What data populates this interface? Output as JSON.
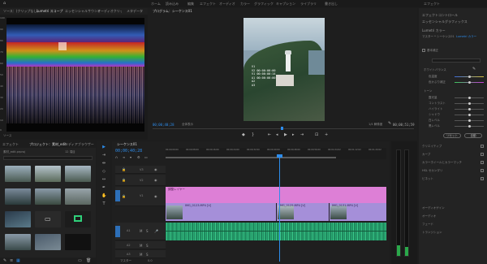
{
  "menu": {
    "items": [
      "ホーム",
      "読み込み",
      "編集",
      "エフェクト",
      "オーディオ",
      "カラー",
      "グラフィック",
      "キャプション",
      "ライブラリ",
      "書き出し"
    ],
    "active_index": 3,
    "right_label": "エフェクト"
  },
  "source_panel": {
    "tabs": [
      "ソース：(クリップなし)",
      "Lumetri スコープ",
      "エッセンシャルサウンド",
      "オーディオクリップミキサー：シーケンス01",
      "メタデータ"
    ],
    "active_tab": 1,
    "bottom_left": "ソース",
    "scale_labels": [
      "100",
      "90",
      "80",
      "70",
      "60",
      "50",
      "40",
      "30",
      "20",
      "10",
      "0"
    ]
  },
  "program": {
    "title": "プログラム：シーケンス01",
    "overlay_lines": [
      "V1",
      "V2 00:00:00:00",
      "V1 00:00:00:14",
      "A1 00:00:00:00",
      "A2",
      "A3"
    ],
    "timecode_left": "00;00;40;28",
    "fit_label": "全体表示",
    "quality_label": "1/4 解像度",
    "timecode_right": "00;00;51;59"
  },
  "effects_panel": {
    "header": "エフェクトコントロール",
    "subheader": "エッセンシャルグラフィックス",
    "sections": [
      "Lumetri カラー",
      "基本補正",
      "クリエイティブ",
      "カーブ",
      "カラーホイールとカラーマッチ",
      "HSL セカンダリ",
      "ビネット"
    ],
    "source_row": "マスター * シーケンス01",
    "clip_row": "Lumetri カラー",
    "sliders": [
      "ホワイトバランス",
      "色温度",
      "色かぶり補正",
      "トーン",
      "露光量",
      "コントラスト",
      "ハイライト",
      "シャドウ",
      "白レベル",
      "黒レベル"
    ],
    "slider_positions": [
      0.5,
      0.5,
      0.5,
      0.5,
      0.5,
      0.5,
      0.5,
      0.5,
      0.5,
      0.5
    ],
    "buttons": [
      "リセット",
      "自動"
    ],
    "lower_items": [
      "オーディオゲイン",
      "オーディオ",
      "フェード",
      "トランジション"
    ]
  },
  "project_panel": {
    "tabs": [
      "エフェクト",
      "プロジェクト：素材_edit",
      "メディアブラウザー"
    ],
    "active_tab": 1,
    "path": "素材_edit.prproj",
    "item_count": "12 項目"
  },
  "timeline": {
    "tab": "シーケンス01",
    "timecode": "00;00;40;28",
    "ruler_labels": [
      "00;00;00;00",
      "00;00;08;00",
      "00;00;16;00",
      "00;00;24;00",
      "00;00;32;00",
      "00;00;40;00",
      "00;00;48;00",
      "00;00;56;00",
      "00;01;04;02",
      "00;01;12;02",
      "00;01;20;02"
    ],
    "tracks_video": [
      "V3",
      "V2",
      "V1"
    ],
    "tracks_audio": [
      "A1",
      "A2",
      "A3"
    ],
    "pink_clip_label": "調整レイヤー",
    "video_clip_labels": [
      "IMG_0123.MP4 [V]",
      "IMG_0125.MP4 [V]",
      "IMG_0131.MP4 [V]"
    ],
    "master_label": "マスター",
    "master_value": "0.0"
  },
  "colors": {
    "accent": "#2d8ceb",
    "pink": "#dd7fd6",
    "video_clip": "#a58fd9",
    "audio_clip": "#1f8a5e"
  }
}
